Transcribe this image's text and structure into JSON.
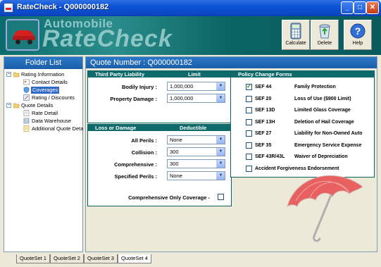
{
  "window": {
    "title": "RateCheck - Q000000182"
  },
  "banner": {
    "brand_top": "Automobile",
    "brand_main": "RateCheck"
  },
  "toolbar": [
    {
      "label": "Calculate",
      "icon": "calculator-icon"
    },
    {
      "label": "Delete",
      "icon": "recycle-bin-icon"
    },
    {
      "label": "Help",
      "icon": "help-icon"
    }
  ],
  "folder_list": {
    "title": "Folder List",
    "items": [
      {
        "label": "Rating Information",
        "level": 0
      },
      {
        "label": "Contact Details",
        "level": 1
      },
      {
        "label": "Coverages",
        "level": 1,
        "selected": true
      },
      {
        "label": "Rating / Discounts",
        "level": 1
      },
      {
        "label": "Quote Details",
        "level": 0
      },
      {
        "label": "Rate Detail",
        "level": 1
      },
      {
        "label": "Data Warehouse",
        "level": 1
      },
      {
        "label": "Additional Quote Deta",
        "level": 1
      }
    ]
  },
  "main": {
    "quote_title": "Quote Number : Q000000182",
    "third_party": {
      "header": "Third Party Liability",
      "col_header": "Limit",
      "fields": [
        {
          "label": "Bodily Injury :",
          "value": "1,000,000"
        },
        {
          "label": "Property Damage :",
          "value": "1,000,000"
        }
      ]
    },
    "loss_damage": {
      "header": "Loss or Damage",
      "col_header": "Deductible",
      "fields": [
        {
          "label": "All Perils :",
          "value": "None"
        },
        {
          "label": "Collision :",
          "value": "300"
        },
        {
          "label": "Comprehensive :",
          "value": "300"
        },
        {
          "label": "Specified Perils :",
          "value": "None"
        }
      ],
      "comp_only_label": "Comprehensive Only Coverage -"
    },
    "policy_change": {
      "header": "Policy Change Forms",
      "forms": [
        {
          "code": "SEF 44",
          "desc": "Family Protection",
          "checked": true
        },
        {
          "code": "SEF 20",
          "desc": "Loss of Use ($900 Limit)",
          "checked": false
        },
        {
          "code": "SEF 13D",
          "desc": "Limited Glass Coverage",
          "checked": false
        },
        {
          "code": "SEF 13H",
          "desc": "Deletion of Hail Coverage",
          "checked": false
        },
        {
          "code": "SEF 27",
          "desc": "Liability for Non-Owned Auto",
          "checked": false
        },
        {
          "code": "SEF 35",
          "desc": "Emergency Service Expense",
          "checked": false
        },
        {
          "code": "SEF 43R/43L",
          "desc": "Waiver of Depreciation",
          "checked": false
        },
        {
          "code": "",
          "desc": "Accident Forgiveness Endorsement",
          "checked": false
        }
      ]
    }
  },
  "tabs": [
    {
      "label": "QuoteSet 1"
    },
    {
      "label": "QuoteSet 2"
    },
    {
      "label": "QuoteSet 3"
    },
    {
      "label": "QuoteSet 4",
      "active": true
    }
  ],
  "colors": {
    "accent": "#0f6b6b",
    "header_blue": "#1b5ea8",
    "umbrella": "#e8605f"
  }
}
